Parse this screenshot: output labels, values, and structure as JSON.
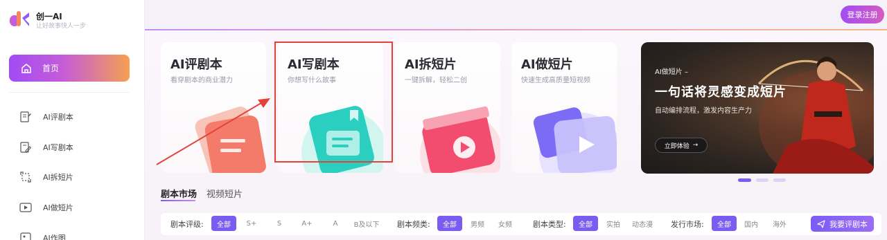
{
  "brand": {
    "name": "创一AI",
    "slogan": "让好故事快人一步"
  },
  "header": {
    "login_label": "登录注册"
  },
  "sidebar": {
    "home_label": "首页",
    "items": [
      {
        "label": "AI评剧本",
        "icon": "document-review-icon"
      },
      {
        "label": "AI写剧本",
        "icon": "edit-document-icon"
      },
      {
        "label": "AI拆短片",
        "icon": "split-crop-icon"
      },
      {
        "label": "AI做短片",
        "icon": "video-play-icon"
      },
      {
        "label": "AI作图",
        "icon": "image-icon"
      }
    ]
  },
  "cards": [
    {
      "title": "AI评剧本",
      "subtitle": "看穿剧本的商业潜力",
      "color": "#f47b6a"
    },
    {
      "title": "AI写剧本",
      "subtitle": "你想写什么故事",
      "color": "#2bcfc0"
    },
    {
      "title": "AI拆短片",
      "subtitle": "一键拆解，轻松二创",
      "color": "#f24d6f"
    },
    {
      "title": "AI做短片",
      "subtitle": "快速生成高质量短视频",
      "color": "#7c6cf5"
    }
  ],
  "banner": {
    "tag": "AI做短片 –",
    "headline": "一句话将灵感变成短片",
    "description": "自动编排流程，激发内容生产力",
    "cta": "立即体验"
  },
  "tabs": {
    "active": "剧本市场",
    "inactive": "视频短片"
  },
  "filters": {
    "rating": {
      "label": "剧本评级:",
      "options": [
        "全部",
        "S+",
        "S",
        "A+",
        "A",
        "B及以下"
      ],
      "selected": "全部"
    },
    "channel": {
      "label": "剧本频类:",
      "options": [
        "全部",
        "男频",
        "女频"
      ],
      "selected": "全部"
    },
    "type": {
      "label": "剧本类型:",
      "options": [
        "全部",
        "实拍",
        "动态漫"
      ],
      "selected": "全部"
    },
    "market": {
      "label": "发行市场:",
      "options": [
        "全部",
        "国内",
        "海外"
      ],
      "selected": "全部"
    }
  },
  "review_button": "我要评剧本",
  "accent": "#7a5cf0"
}
